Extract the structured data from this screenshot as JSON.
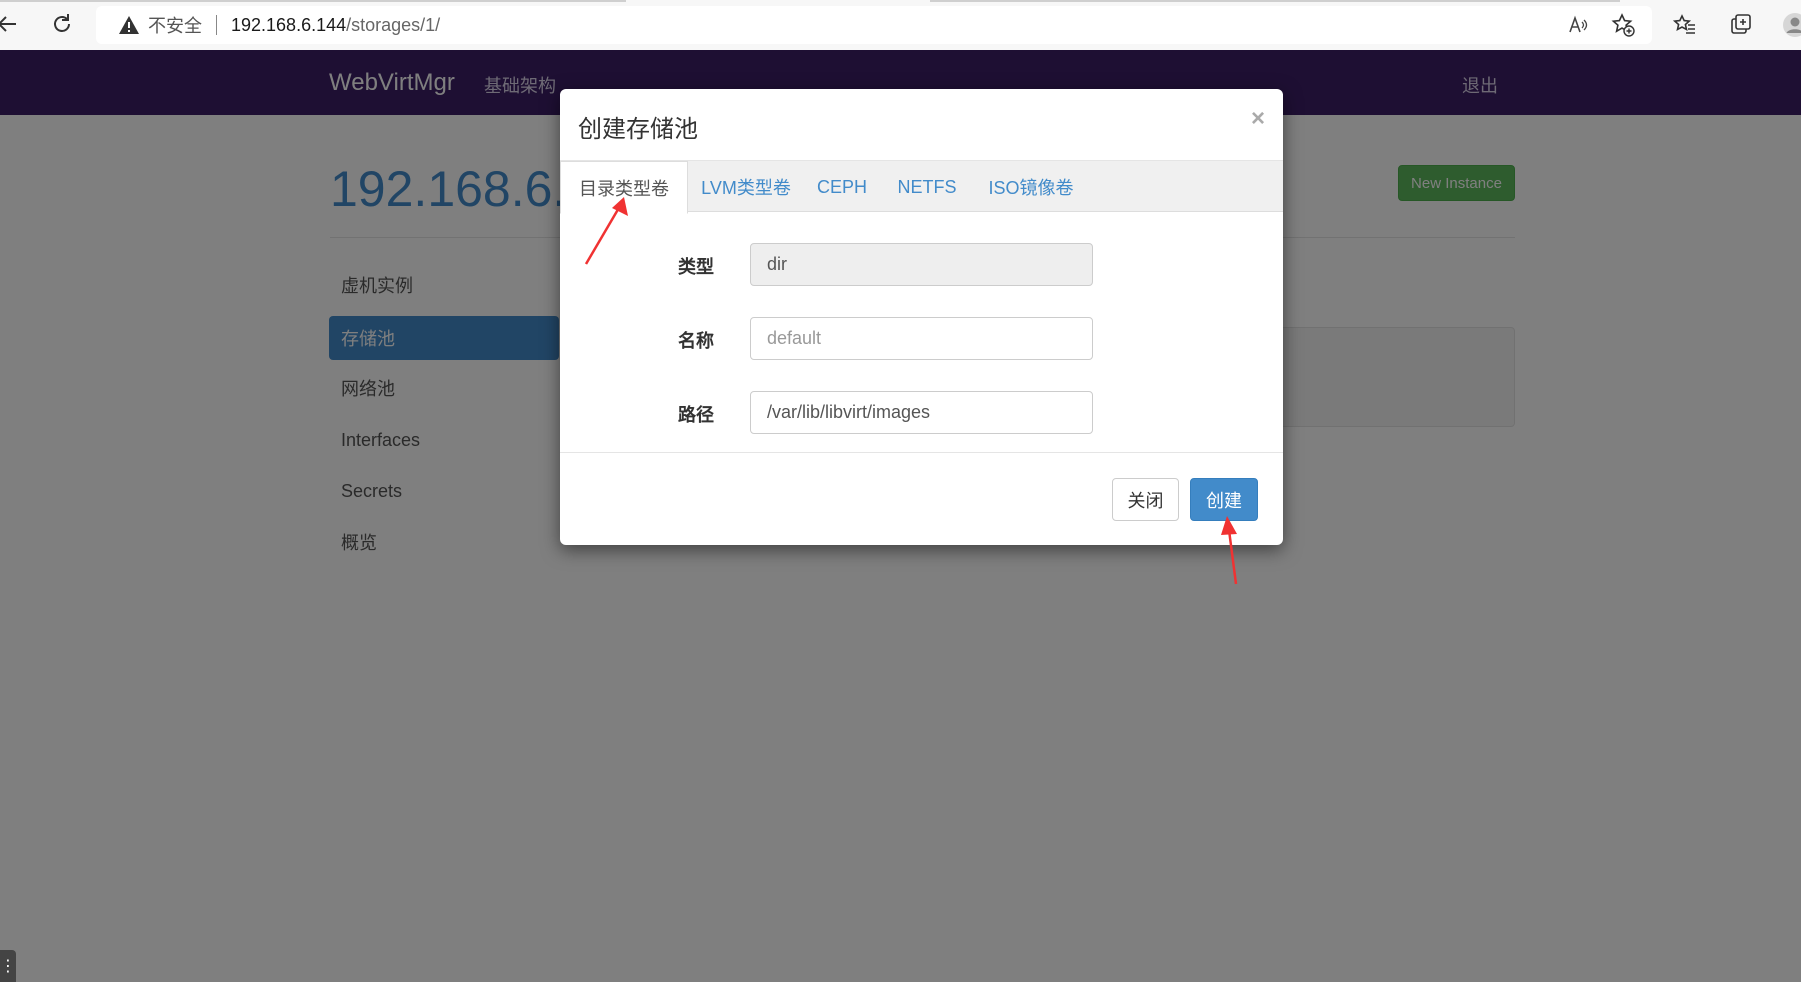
{
  "browser": {
    "address": {
      "insecure_label": "不安全",
      "host": "192.168.6.144",
      "path": "/storages/1/"
    },
    "icons": [
      "back-icon",
      "reload-icon",
      "warning-icon",
      "read-aloud-icon",
      "add-favorite-icon",
      "favorites-icon",
      "collections-icon",
      "profile-icon"
    ]
  },
  "navbar": {
    "brand": "WebVirtMgr",
    "infrastructure": "基础架构",
    "logout": "退出"
  },
  "page": {
    "title": "192.168.6.1",
    "new_instance": "New Instance"
  },
  "sidebar": {
    "items": [
      {
        "label": "虚机实例",
        "active": false
      },
      {
        "label": "存储池",
        "active": true
      },
      {
        "label": "网络池",
        "active": false
      },
      {
        "label": "Interfaces",
        "active": false
      },
      {
        "label": "Secrets",
        "active": false
      },
      {
        "label": "概览",
        "active": false
      }
    ]
  },
  "modal": {
    "title": "创建存储池",
    "close_symbol": "×",
    "tabs": [
      {
        "label": "目录类型卷",
        "active": true
      },
      {
        "label": "LVM类型卷",
        "active": false
      },
      {
        "label": "CEPH",
        "active": false
      },
      {
        "label": "NETFS",
        "active": false
      },
      {
        "label": "ISO镜像卷",
        "active": false
      }
    ],
    "fields": {
      "type_label": "类型",
      "type_value": "dir",
      "name_label": "名称",
      "name_placeholder": "default",
      "path_label": "路径",
      "path_value": "/var/lib/libvirt/images"
    },
    "buttons": {
      "close": "关闭",
      "create": "创建"
    }
  },
  "colors": {
    "navbar": "#3c1e66",
    "primary": "#428bca",
    "success": "#5cb85c",
    "annotation": "#f03232"
  }
}
